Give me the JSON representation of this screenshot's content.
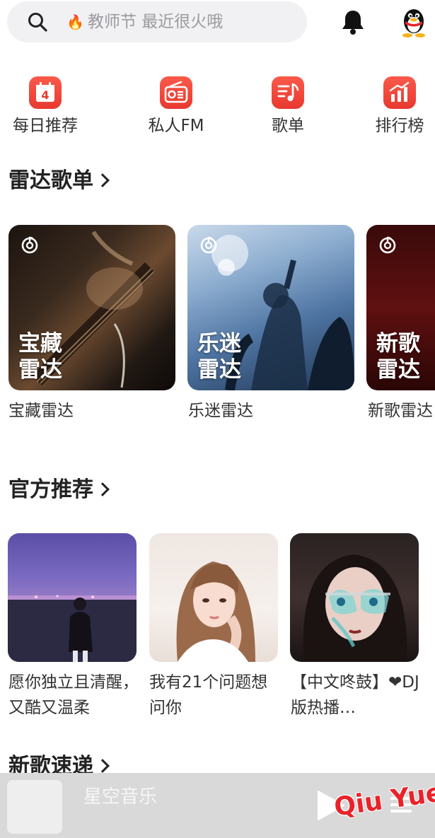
{
  "search": {
    "fire_icon": "fire-icon",
    "placeholder": "教师节 最近很火哦"
  },
  "header": {
    "bell_icon": "bell-icon",
    "avatar_icon": "qq-penguin-icon"
  },
  "quick_entries": [
    {
      "label": "每日推荐",
      "icon": "calendar-icon",
      "badge": "4"
    },
    {
      "label": "私人FM",
      "icon": "radio-icon"
    },
    {
      "label": "歌单",
      "icon": "playlist-icon"
    },
    {
      "label": "排行榜",
      "icon": "chart-icon"
    }
  ],
  "radar": {
    "title": "雷达歌单",
    "items": [
      {
        "overlay": "宝藏\n雷达",
        "label": "宝藏雷达"
      },
      {
        "overlay": "乐迷\n雷达",
        "label": "乐迷雷达"
      },
      {
        "overlay": "新歌\n雷达",
        "label": "新歌雷达"
      }
    ]
  },
  "official": {
    "title": "官方推荐",
    "items": [
      {
        "label": "愿你独立且清醒，又酷又温柔"
      },
      {
        "label": "我有21个问题想问你"
      },
      {
        "label": "【中文咚鼓】❤DJ版热播…"
      }
    ]
  },
  "next_section": {
    "title": "新歌速递"
  },
  "player": {
    "song": "星空音乐",
    "watermark": "Qiu Yue"
  },
  "colors": {
    "accent": "#e8392f",
    "text": "#222222",
    "muted": "#9b9b9f"
  }
}
